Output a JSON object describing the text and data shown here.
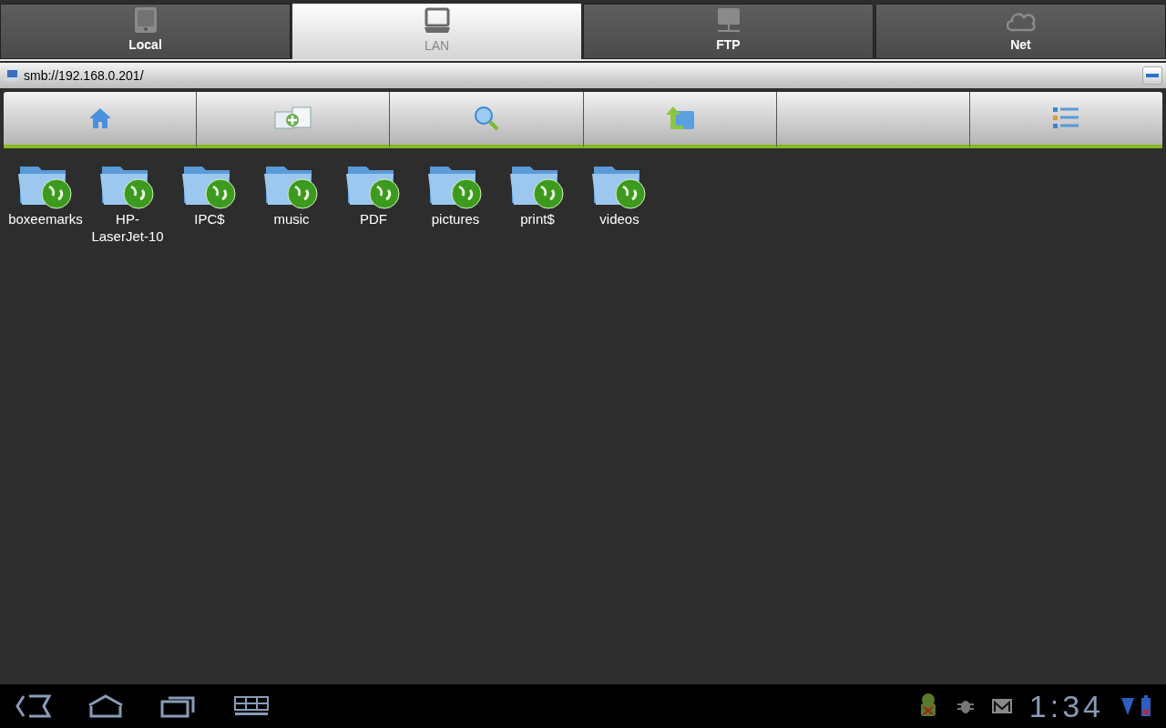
{
  "tabs": [
    {
      "label": "Local",
      "selected": false
    },
    {
      "label": "LAN",
      "selected": true
    },
    {
      "label": "FTP",
      "selected": false
    },
    {
      "label": "Net",
      "selected": false
    }
  ],
  "path_bar": {
    "path": "smb://192.168.0.201/"
  },
  "items": [
    {
      "name": "boxeemarks"
    },
    {
      "name": "HP-LaserJet-10"
    },
    {
      "name": "IPC$"
    },
    {
      "name": "music"
    },
    {
      "name": "PDF"
    },
    {
      "name": "pictures"
    },
    {
      "name": "print$"
    },
    {
      "name": "videos"
    }
  ],
  "status_bar": {
    "time": "1:34"
  }
}
